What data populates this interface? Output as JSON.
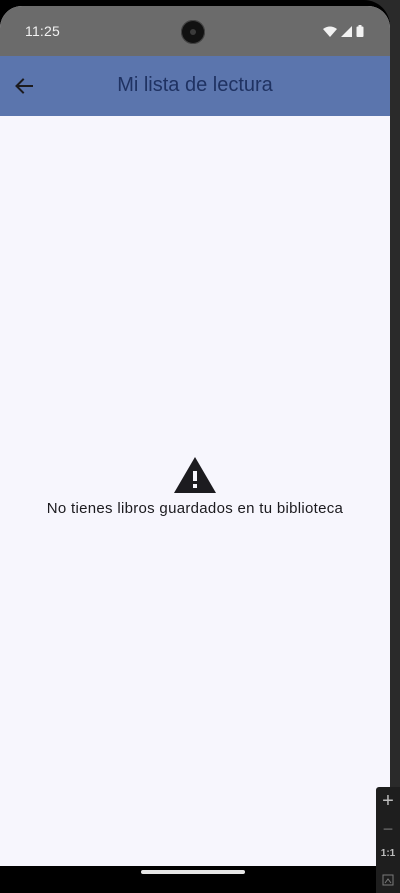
{
  "status_bar": {
    "time": "11:25",
    "icons": [
      "wifi-icon",
      "signal-icon",
      "battery-icon"
    ]
  },
  "app_bar": {
    "title": "Mi lista de lectura",
    "back_icon": "arrow-left-icon"
  },
  "empty_state": {
    "icon": "warning-icon",
    "message": "No tienes libros guardados en tu biblioteca"
  },
  "side_toolbar": {
    "zoom_in": "+",
    "zoom_out": "−",
    "actual_size": "1:1",
    "fit_icon": "fit-screen-icon"
  },
  "colors": {
    "app_bar": "#5b75ad",
    "title": "#1f3262",
    "background": "#f7f6fd",
    "status_bar": "#6b6b6b"
  }
}
